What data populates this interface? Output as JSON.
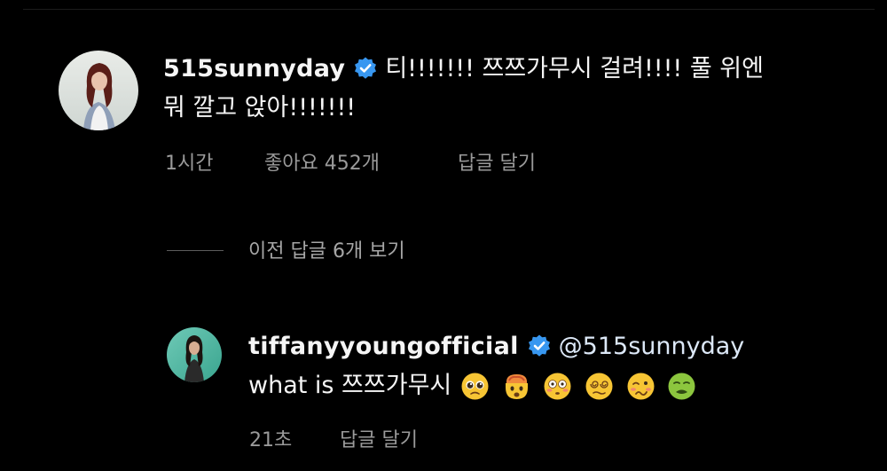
{
  "comment": {
    "username": "515sunnyday",
    "verified_icon": "verified-badge-icon",
    "text_line1": "티!!!!!!! 쯔쯔가무시 걸려!!!! 풀 위엔",
    "text_line2": "뭐 깔고 앉아!!!!!!!",
    "time": "1시간",
    "likes": "좋아요 452개",
    "reply_label": "답글 달기"
  },
  "view_previous_replies": "이전 답글 6개 보기",
  "reply": {
    "username": "tiffanyyoungofficial",
    "verified_icon": "verified-badge-icon",
    "mention": "@515sunnyday",
    "text": "what is 쯔쯔가무시",
    "emojis": [
      "pleading-face-emoji",
      "exploding-head-emoji",
      "flushed-face-emoji",
      "dizzy-face-emoji",
      "woozy-face-emoji",
      "nauseated-face-emoji"
    ],
    "time": "21초",
    "reply_label": "답글 달기"
  },
  "colors": {
    "background": "#000000",
    "text": "#f5f5f5",
    "meta_text": "#9a9a9a",
    "verified_blue": "#3897f0"
  }
}
